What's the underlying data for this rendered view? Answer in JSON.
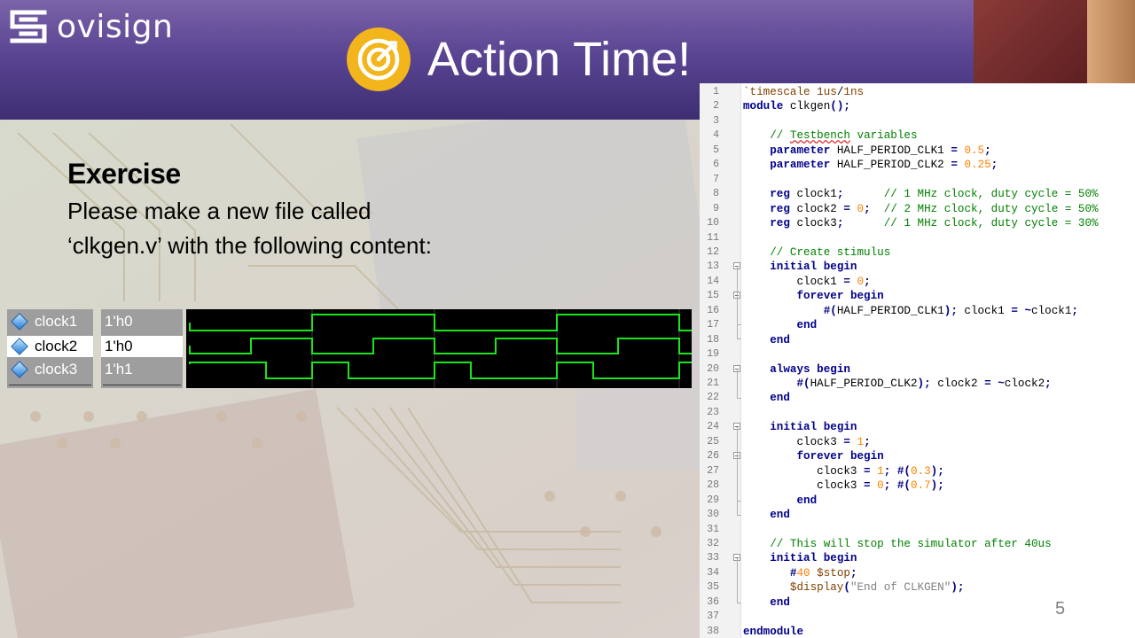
{
  "brand": {
    "name": "ovisign"
  },
  "slide": {
    "title": "Action Time!",
    "page_number": "5"
  },
  "exercise": {
    "heading": "Exercise",
    "line1": "Please make a new file called",
    "line2": "‘clkgen.v’ with the following content:"
  },
  "waveform": {
    "signals": [
      {
        "name": "clock1",
        "value": "1'h0",
        "selected": false
      },
      {
        "name": "clock2",
        "value": "1'h0",
        "selected": true
      },
      {
        "name": "clock3",
        "value": "1'h1",
        "selected": false
      }
    ],
    "trace_color": "#19e619",
    "background_color": "#000000"
  },
  "code": {
    "lines": [
      {
        "n": "1",
        "text": "`timescale 1us/1ns"
      },
      {
        "n": "2",
        "text": "module clkgen();"
      },
      {
        "n": "3",
        "text": ""
      },
      {
        "n": "4",
        "text": "    // Testbench variables"
      },
      {
        "n": "5",
        "text": "    parameter HALF_PERIOD_CLK1 = 0.5;"
      },
      {
        "n": "6",
        "text": "    parameter HALF_PERIOD_CLK2 = 0.25;"
      },
      {
        "n": "7",
        "text": ""
      },
      {
        "n": "8",
        "text": "    reg clock1;      // 1 MHz clock, duty cycle = 50%"
      },
      {
        "n": "9",
        "text": "    reg clock2 = 0;  // 2 MHz clock, duty cycle = 50%"
      },
      {
        "n": "10",
        "text": "    reg clock3;      // 1 MHz clock, duty cycle = 30%"
      },
      {
        "n": "11",
        "text": ""
      },
      {
        "n": "12",
        "text": "    // Create stimulus"
      },
      {
        "n": "13",
        "text": "    initial begin"
      },
      {
        "n": "14",
        "text": "        clock1 = 0;"
      },
      {
        "n": "15",
        "text": "        forever begin"
      },
      {
        "n": "16",
        "text": "            #(HALF_PERIOD_CLK1); clock1 = ~clock1;"
      },
      {
        "n": "17",
        "text": "        end"
      },
      {
        "n": "18",
        "text": "    end"
      },
      {
        "n": "19",
        "text": ""
      },
      {
        "n": "20",
        "text": "    always begin"
      },
      {
        "n": "21",
        "text": "        #(HALF_PERIOD_CLK2); clock2 = ~clock2;"
      },
      {
        "n": "22",
        "text": "    end"
      },
      {
        "n": "23",
        "text": ""
      },
      {
        "n": "24",
        "text": "    initial begin"
      },
      {
        "n": "25",
        "text": "        clock3 = 1;"
      },
      {
        "n": "26",
        "text": "        forever begin"
      },
      {
        "n": "27",
        "text": "           clock3 = 1; #(0.3);"
      },
      {
        "n": "28",
        "text": "           clock3 = 0; #(0.7);"
      },
      {
        "n": "29",
        "text": "        end"
      },
      {
        "n": "30",
        "text": "    end"
      },
      {
        "n": "31",
        "text": ""
      },
      {
        "n": "32",
        "text": "    // This will stop the simulator after 40us"
      },
      {
        "n": "33",
        "text": "    initial begin"
      },
      {
        "n": "34",
        "text": "       #40 $stop;"
      },
      {
        "n": "35",
        "text": "       $display(\"End of CLKGEN\");"
      },
      {
        "n": "36",
        "text": "    end"
      },
      {
        "n": "37",
        "text": ""
      },
      {
        "n": "38",
        "text": "endmodule"
      }
    ]
  },
  "colors": {
    "header": "#5a4593",
    "target_icon": "#f2b51b"
  }
}
